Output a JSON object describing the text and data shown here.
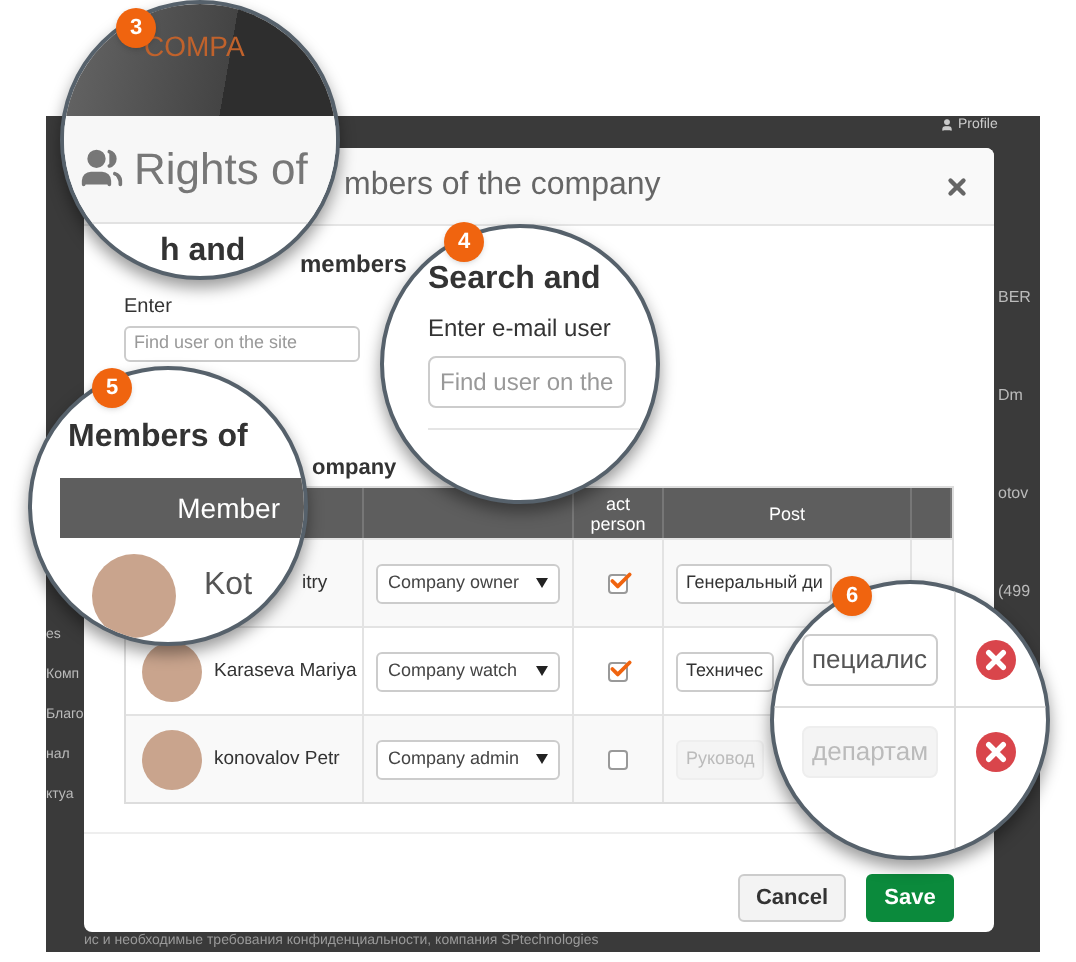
{
  "page": {
    "profile_link": "Profile",
    "left_texts": [
      "es",
      "Комп",
      "Благо",
      "нал",
      "ктуа"
    ],
    "right_texts": [
      "BER",
      "Dm",
      "otov",
      "(499"
    ],
    "bottom_text": "ис и необходимые требования конфиденциальности, компания SPtechnologies"
  },
  "modal": {
    "title": "mbers of the company",
    "search_heading": "members",
    "field_label": "Enter",
    "search_placeholder": "Find user on the site",
    "section_heading": "ompany",
    "columns": [
      "",
      "",
      "act person",
      "Post",
      ""
    ],
    "rows": [
      {
        "name": "itry",
        "role": "Company owner",
        "contact": true,
        "post": "Генеральный ди",
        "disabled": false
      },
      {
        "name": "Karaseva Mariya",
        "role": "Company watch",
        "contact": true,
        "post": "Техничес",
        "disabled": false
      },
      {
        "name": "konovalov Petr",
        "role": "Company admin",
        "contact": false,
        "post": "Руковод",
        "disabled": true
      }
    ],
    "buttons": [
      {
        "label": "Cancel",
        "kind": "secondary"
      },
      {
        "label": "Save",
        "kind": "primary"
      }
    ]
  },
  "magnifiers": [
    {
      "kind": "title",
      "badge": "3",
      "brand": "COMPA",
      "title": "Rights of",
      "heading": "h and"
    },
    {
      "kind": "search",
      "badge": "4",
      "heading": "Search and",
      "label": "Enter e-mail user",
      "placeholder": "Find user on the"
    },
    {
      "kind": "table",
      "badge": "5",
      "heading": "Members of",
      "column": "Member",
      "name": "Kot"
    },
    {
      "kind": "posts",
      "badge": "6",
      "posts": [
        {
          "text": "пециалис",
          "disabled": false
        },
        {
          "text": "департам",
          "disabled": true
        }
      ]
    }
  ]
}
